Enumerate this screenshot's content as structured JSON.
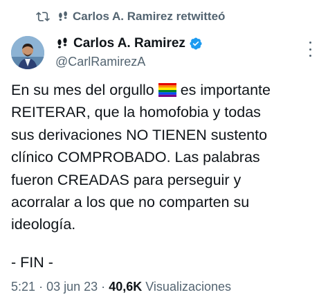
{
  "retweet": {
    "icon": "retweet-icon",
    "text": "Carlos A. Ramirez retwitteó"
  },
  "author": {
    "name": "Carlos A. Ramirez",
    "handle": "@CarlRamirezA",
    "verified": true,
    "accent_color": "#1d9bf0"
  },
  "tweet": {
    "text_before_flag": "En su mes del orgullo ",
    "flag_icon": "rainbow-flag-icon",
    "text_after_flag": " es importante\nREITERAR, que la homofobia y todas\nsus derivaciones NO TIENEN sustento\nclínico COMPROBADO. Las palabras\nfueron CREADAS para perseguir y\nacorralar a los que no comparten su\nideología.",
    "closing": "- FIN -"
  },
  "meta": {
    "time": "5:21",
    "separator": "·",
    "date": "03 jun 23",
    "views_count": "40,6K",
    "views_label": "Visualizaciones"
  }
}
